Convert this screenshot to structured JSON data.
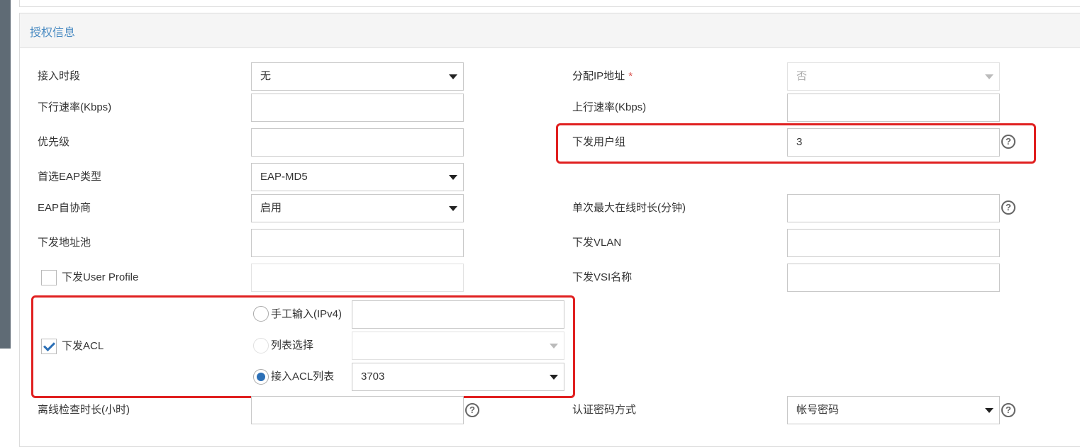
{
  "section": {
    "title": "授权信息"
  },
  "fields": {
    "access_period": {
      "label": "接入时段",
      "value": "无"
    },
    "assign_ip": {
      "label": "分配IP地址",
      "required_mark": "*",
      "value": "否"
    },
    "down_rate": {
      "label": "下行速率(Kbps)",
      "value": ""
    },
    "up_rate": {
      "label": "上行速率(Kbps)",
      "value": ""
    },
    "priority": {
      "label": "优先级",
      "value": ""
    },
    "user_group": {
      "label": "下发用户组",
      "value": "3"
    },
    "eap_type": {
      "label": "首选EAP类型",
      "value": "EAP-MD5"
    },
    "eap_negotiation": {
      "label": "EAP自协商",
      "value": "启用"
    },
    "max_online": {
      "label": "单次最大在线时长(分钟)",
      "value": ""
    },
    "address_pool": {
      "label": "下发地址池",
      "value": ""
    },
    "vlan": {
      "label": "下发VLAN",
      "value": ""
    },
    "user_profile": {
      "label": "下发User Profile",
      "checked": false,
      "value": ""
    },
    "vsi_name": {
      "label": "下发VSI名称",
      "value": ""
    },
    "acl": {
      "label": "下发ACL",
      "checked": true,
      "options": [
        {
          "label": "手工输入(IPv4)",
          "selected": false,
          "value": ""
        },
        {
          "label": "列表选择",
          "selected": false,
          "value": ""
        },
        {
          "label": "接入ACL列表",
          "selected": true,
          "value": "3703"
        }
      ]
    },
    "offline_check": {
      "label": "离线检查时长(小时)",
      "value": ""
    },
    "auth_password": {
      "label": "认证密码方式",
      "value": "帐号密码"
    }
  },
  "icons": {
    "help": "question-circle-icon",
    "dropdown": "caret-down-icon",
    "check": "check-icon"
  },
  "colors": {
    "title": "#4a8bc2",
    "highlight": "#e02020",
    "accent": "#2b6fb6",
    "required": "#d9534f"
  }
}
